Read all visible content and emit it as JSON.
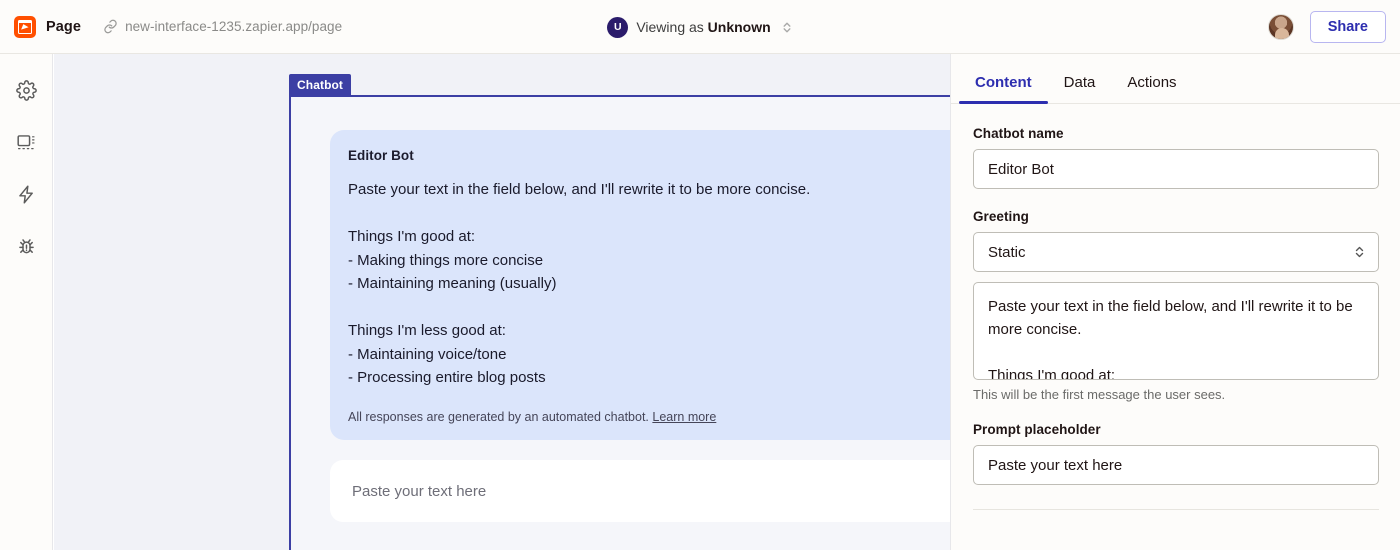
{
  "topbar": {
    "logo_icon": "zapier-page-icon",
    "page_label": "Page",
    "link_icon": "link-icon",
    "url": "new-interface-1235.zapier.app/page",
    "viewer_avatar_initial": "U",
    "viewing_prefix": "Viewing as ",
    "viewing_name": "Unknown",
    "viewer_chevron_icon": "chevron-up-down-icon",
    "share_label": "Share",
    "accent_color": "#2D2EAF",
    "brand_color": "#FF4F00"
  },
  "sidebar": {
    "items": [
      {
        "name": "settings",
        "icon": "gear-icon"
      },
      {
        "name": "layout",
        "icon": "layout-icon"
      },
      {
        "name": "automation",
        "icon": "lightning-bolt-icon"
      },
      {
        "name": "debug",
        "icon": "bug-icon"
      }
    ]
  },
  "canvas": {
    "widget_tag": "Chatbot",
    "widget_border_color": "#3C3FA4",
    "bubble_bg": "#DBE5FB",
    "bot_name": "Editor Bot",
    "greeting": "Paste your text in the field below, and I'll rewrite it to be more concise.\n\nThings I'm good at:\n- Making things more concise\n- Maintaining meaning (usually)\n\nThings I'm less good at:\n- Maintaining voice/tone\n- Processing entire blog posts",
    "disclaimer": "All responses are generated by an automated chatbot. ",
    "disclaimer_link": "Learn more",
    "prompt_placeholder": "Paste your text here"
  },
  "panel": {
    "tabs": [
      {
        "label": "Content",
        "active": true
      },
      {
        "label": "Data",
        "active": false
      },
      {
        "label": "Actions",
        "active": false
      }
    ],
    "fields": {
      "chatbot_name_label": "Chatbot name",
      "chatbot_name_value": "Editor Bot",
      "greeting_label": "Greeting",
      "greeting_type_value": "Static",
      "greeting_select_icon": "chevron-up-down-icon",
      "greeting_text_value": "Paste your text in the field below, and I'll rewrite it to be more concise.\n\nThings I'm good at:",
      "greeting_help": "This will be the first message the user sees.",
      "prompt_placeholder_label": "Prompt placeholder",
      "prompt_placeholder_value": "Paste your text here"
    }
  }
}
